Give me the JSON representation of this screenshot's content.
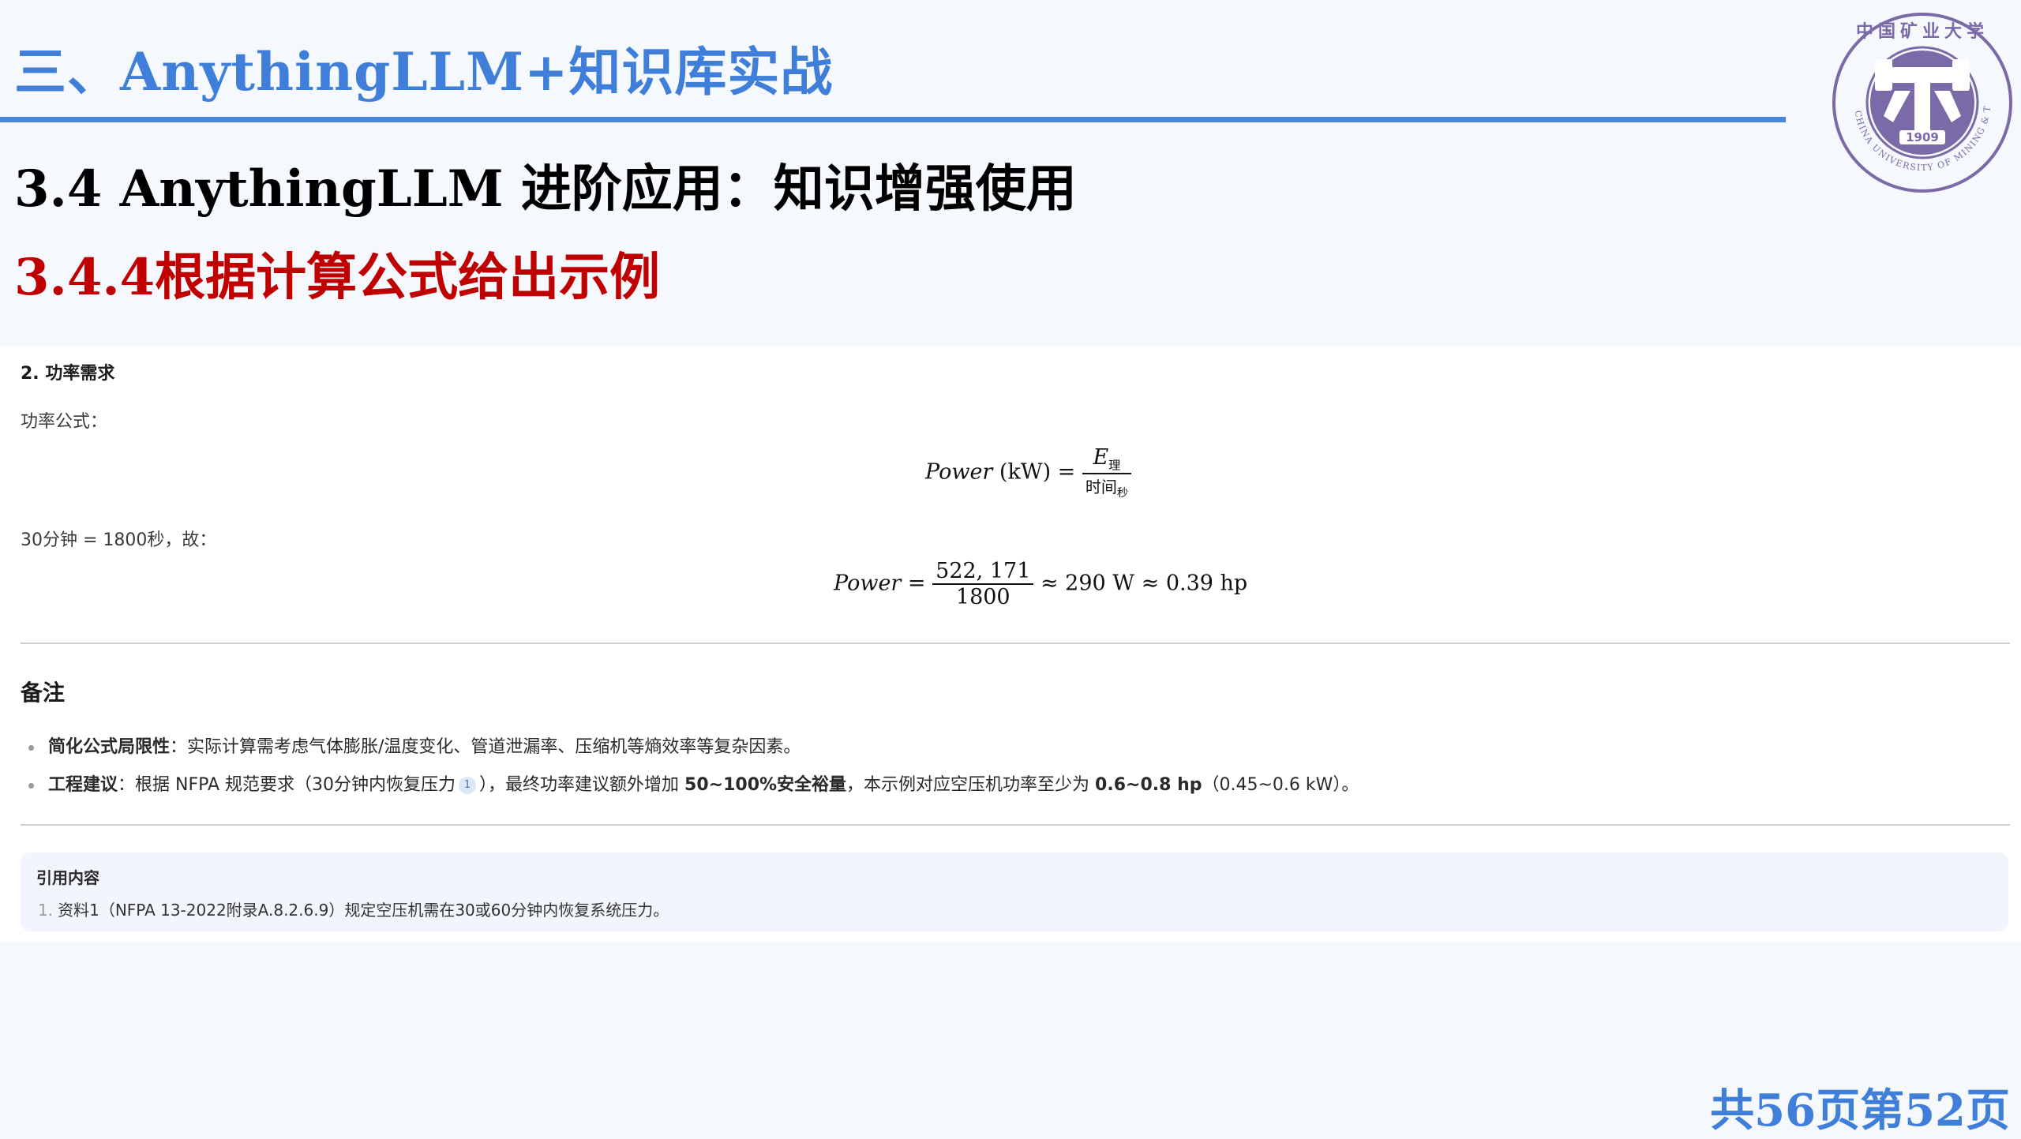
{
  "header": {
    "section_title": "三、AnythingLLM+知识库实战",
    "slide_heading": "3.4 AnythingLLM 进阶应用：知识增强使用",
    "slide_subheading": "3.4.4根据计算公式给出示例"
  },
  "logo": {
    "top_text": "中国矿业大学",
    "ring_text": "CHINA UNIVERSITY OF MINING & TECHNOLOGY",
    "year": "1909"
  },
  "content": {
    "power_heading": "2. 功率需求",
    "formula_intro": "功率公式：",
    "formula1": {
      "lhs_var": "Power",
      "lhs_unit": "(kW) =",
      "numerator": "E",
      "numerator_sub": "理",
      "denominator": "时间",
      "denominator_sub": "秒"
    },
    "calc_intro": "30分钟 = 1800秒，故：",
    "formula2": {
      "lhs_var": "Power",
      "eq": "=",
      "numerator": "522, 171",
      "denominator": "1800",
      "result": "≈ 290 W ≈ 0.39 hp"
    },
    "notes_heading": "备注",
    "notes": [
      {
        "bold": "简化公式局限性",
        "text": "：实际计算需考虑气体膨胀/温度变化、管道泄漏率、压缩机等熵效率等复杂因素。"
      },
      {
        "bold": "工程建议",
        "text_a": "：根据 NFPA 规范要求（30分钟内恢复压力",
        "citation": "1",
        "text_b": "），最终功率建议额外增加 ",
        "bold2": "50~100%安全裕量",
        "text_c": "，本示例对应空压机功率至少为 ",
        "bold3": "0.6~0.8 hp",
        "text_d": "（0.45~0.6 kW）。"
      }
    ],
    "references_heading": "引用内容",
    "references": [
      {
        "index": "1.",
        "text": "资料1（NFPA 13-2022附录A.8.2.6.9）规定空压机需在30或60分钟内恢复系统压力。"
      }
    ]
  },
  "footer": {
    "page_counter": "共56页第52页"
  },
  "colors": {
    "accent_blue": "#3f7fd9",
    "heading_red": "#c00000",
    "logo_purple": "#7a6aa8"
  }
}
